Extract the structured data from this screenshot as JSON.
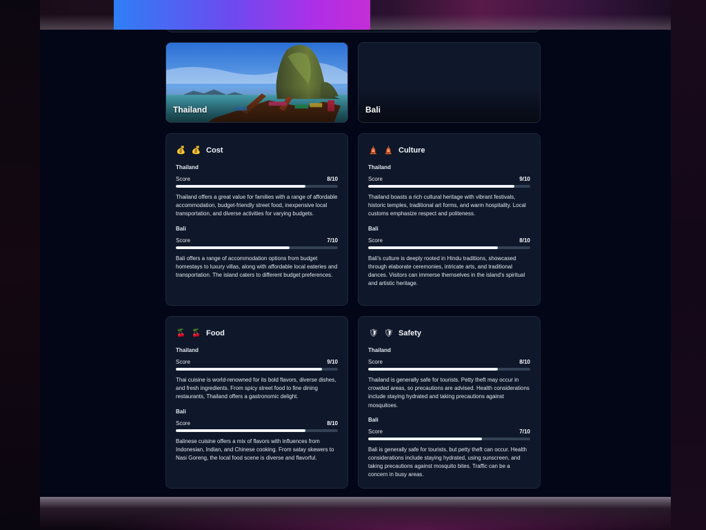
{
  "destinations": [
    {
      "name": "Thailand"
    },
    {
      "name": "Bali"
    }
  ],
  "score_label": "Score",
  "categories": {
    "cost": {
      "icon": "money-bag-icon",
      "emoji": "💰",
      "title": "Cost",
      "entries": [
        {
          "country": "Thailand",
          "score_text": "8/10",
          "score": 8,
          "max": 10,
          "description": "Thailand offers a great value for families with a range of affordable accommodation, budget-friendly street food, inexpensive local transportation, and diverse activities for varying budgets."
        },
        {
          "country": "Bali",
          "score_text": "7/10",
          "score": 7,
          "max": 10,
          "description": "Bali offers a range of accommodation options from budget homestays to luxury villas, along with affordable local eateries and transportation. The island caters to different budget preferences."
        }
      ]
    },
    "culture": {
      "icon": "temple-icon",
      "emoji": "🛕",
      "title": "Culture",
      "entries": [
        {
          "country": "Thailand",
          "score_text": "9/10",
          "score": 9,
          "max": 10,
          "description": "Thailand boasts a rich cultural heritage with vibrant festivals, historic temples, traditional art forms, and warm hospitality. Local customs emphasize respect and politeness."
        },
        {
          "country": "Bali",
          "score_text": "8/10",
          "score": 8,
          "max": 10,
          "description": "Bali's culture is deeply rooted in Hindu traditions, showcased through elaborate ceremonies, intricate arts, and traditional dances. Visitors can immerse themselves in the island's spiritual and artistic heritage."
        }
      ]
    },
    "food": {
      "icon": "cherries-icon",
      "emoji": "🍒",
      "title": "Food",
      "entries": [
        {
          "country": "Thailand",
          "score_text": "9/10",
          "score": 9,
          "max": 10,
          "description": "Thai cuisine is world-renowned for its bold flavors, diverse dishes, and fresh ingredients. From spicy street food to fine dining restaurants, Thailand offers a gastronomic delight."
        },
        {
          "country": "Bali",
          "score_text": "8/10",
          "score": 8,
          "max": 10,
          "description": "Balinese cuisine offers a mix of flavors with influences from Indonesian, Indian, and Chinese cooking. From satay skewers to Nasi Goreng, the local food scene is diverse and flavorful."
        }
      ]
    },
    "safety": {
      "icon": "shield-icon",
      "emoji": "🛡",
      "title": "Safety",
      "entries": [
        {
          "country": "Thailand",
          "score_text": "8/10",
          "score": 8,
          "max": 10,
          "description": "Thailand is generally safe for tourists. Petty theft may occur in crowded areas, so precautions are advised. Health considerations include staying hydrated and taking precautions against mosquitoes."
        },
        {
          "country": "Bali",
          "score_text": "7/10",
          "score": 7,
          "max": 10,
          "description": "Bali is generally safe for tourists, but petty theft can occur. Health considerations include staying hydrated, using sunscreen, and taking precautions against mosquito bites. Traffic can be a concern in busy areas."
        }
      ]
    }
  },
  "colors": {
    "background": "#020617",
    "card": "#0f172a",
    "card_border": "#1e293b",
    "bar_track": "#334155",
    "bar_fill": "#f1f5f9",
    "accent_gradient_start": "#2f7ff5",
    "accent_gradient_end": "#c42ed6"
  }
}
